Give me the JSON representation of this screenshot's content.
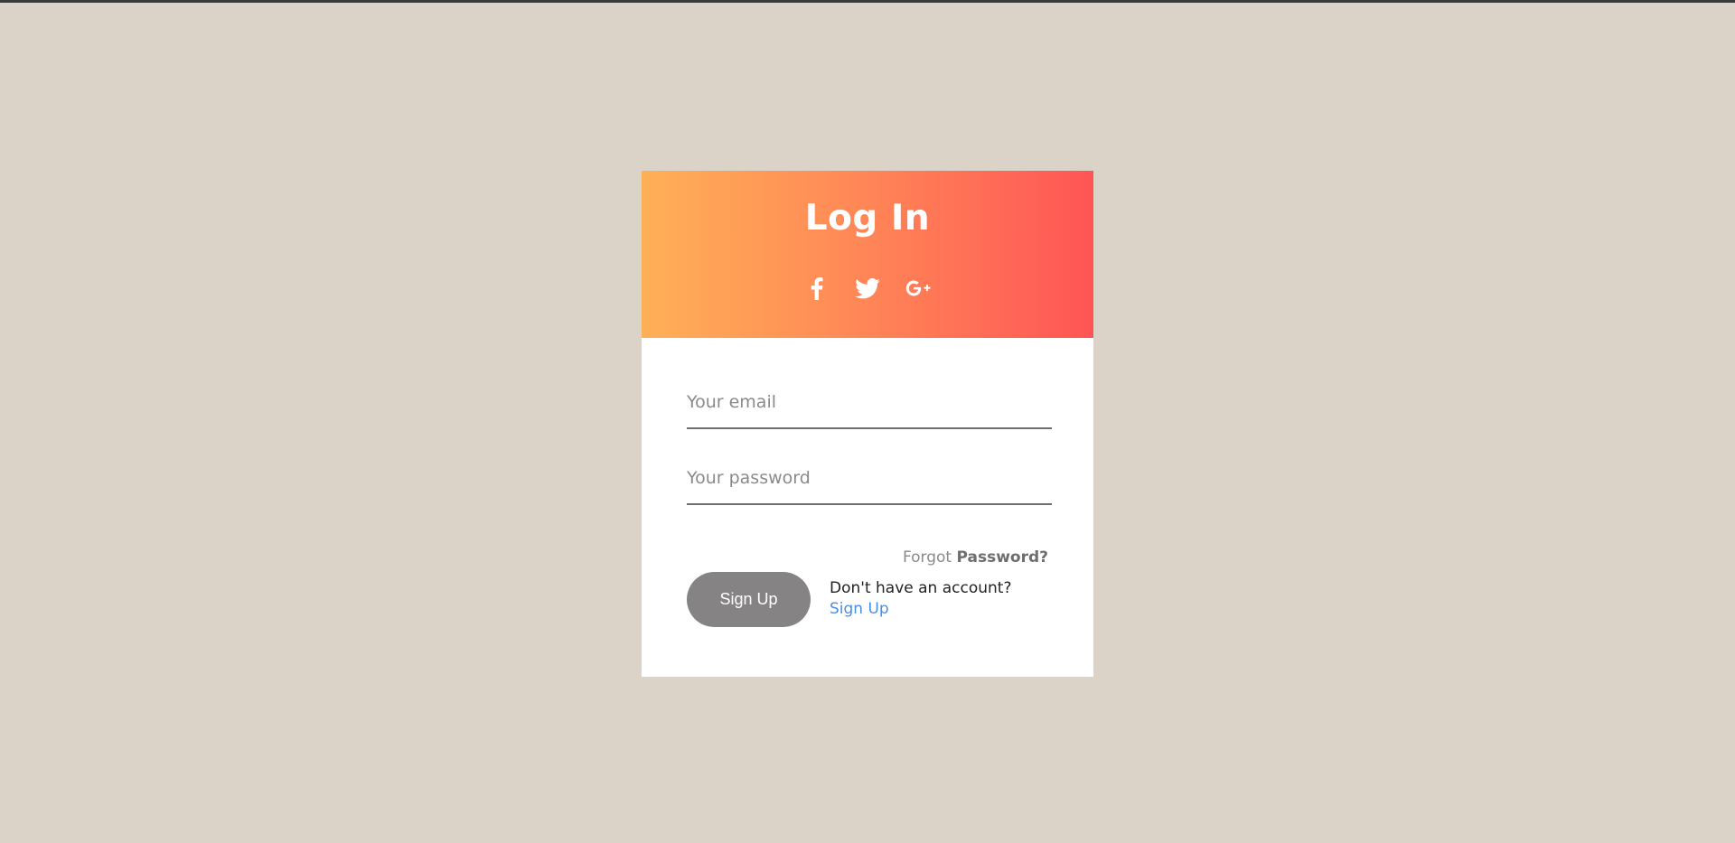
{
  "header": {
    "title": "Log In",
    "social": [
      {
        "name": "facebook-icon"
      },
      {
        "name": "twitter-icon"
      },
      {
        "name": "google-plus-icon"
      }
    ]
  },
  "form": {
    "email_placeholder": "Your email",
    "email_value": "",
    "password_placeholder": "Your password",
    "password_value": "",
    "forgot_prefix": "Forgot",
    "forgot_bold": "Password?",
    "signup_button": "Sign Up",
    "account_prompt": "Don't have an account?",
    "account_link": "Sign Up"
  },
  "colors": {
    "background": "#dbd3c8",
    "gradient_start": "#ffb057",
    "gradient_end": "#ff5555",
    "button": "#858383",
    "link": "#4a90e2"
  }
}
